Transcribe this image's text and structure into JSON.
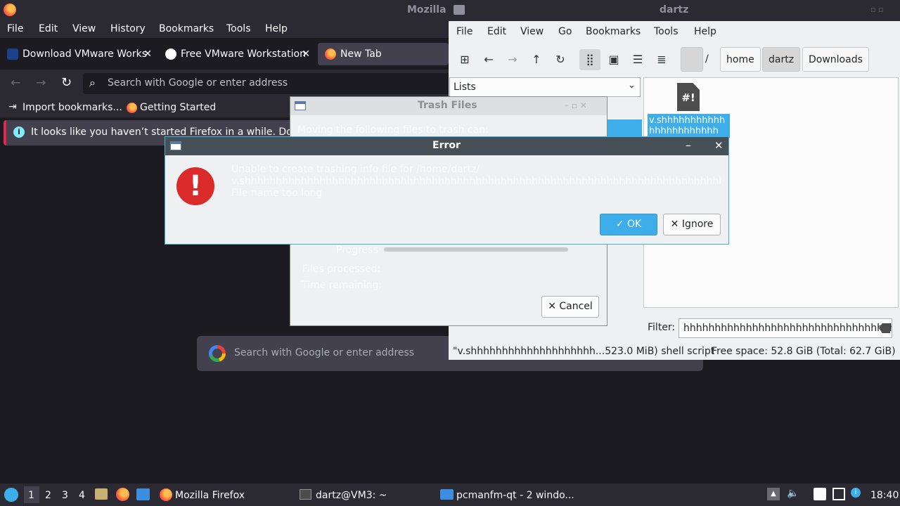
{
  "firefox": {
    "window_title": "Mozilla",
    "menu": [
      "File",
      "Edit",
      "View",
      "History",
      "Bookmarks",
      "Tools",
      "Help"
    ],
    "tabs": [
      {
        "label": "Download VMware Works"
      },
      {
        "label": "Free VMware Workstation"
      },
      {
        "label": "New Tab"
      }
    ],
    "urlbar_placeholder": "Search with Google or enter address",
    "bookmarks": [
      "Import bookmarks...",
      "Getting Started"
    ],
    "infobar_text": "It looks like you haven’t started Firefox in a while. Do v",
    "newtab_search_placeholder": "Search with Google or enter address"
  },
  "filemanager": {
    "window_title": "dartz",
    "menu": [
      "File",
      "Edit",
      "View",
      "Go",
      "Bookmarks",
      "Tools",
      "Help"
    ],
    "breadcrumbs": [
      "/",
      "home",
      "dartz",
      "Downloads"
    ],
    "side_pane_mode": "Lists",
    "file_icon_glyph": "#!",
    "file_label": "v.shhhhhhhhhhhhhhhhhhhhhhh",
    "filter_label": "Filter:",
    "filter_value": "hhhhhhhhhhhhhhhhhhhhhhhhhhhhhhhhhhh",
    "status_text": "\"v.shhhhhhhhhhhhhhhhhhhh...523.0 MiB) shell script",
    "free_space": "Free space: 52.8 GiB (Total: 62.7 GiB)"
  },
  "trash_dialog": {
    "title": "Trash Files",
    "message": "Moving the following files to trash can:",
    "progress_label": "Progress",
    "files_processed_label": "Files processed:",
    "time_remaining_label": "Time remaining:",
    "cancel_label": "Cancel"
  },
  "error_dialog": {
    "title": "Error",
    "line1": "Unable to create trashing info file for /home/dartz/",
    "line2": "v.shhhhhhhhhhhhhhhhhhhhhhhhhhhhhhhhhhhhhhhhhhhhhhhhhhhhhhhhhhhhhhhhhhhhhhhhhhhhhhhhhhhhhhhhh",
    "line3": "File name too long",
    "ok_label": "OK",
    "ignore_label": "Ignore"
  },
  "taskbar": {
    "workspaces": [
      "1",
      "2",
      "3",
      "4"
    ],
    "tasks": [
      "Mozilla Firefox",
      "dartz@VM3: ~",
      "pcmanfm-qt - 2 windo..."
    ],
    "clock": "18:40"
  }
}
